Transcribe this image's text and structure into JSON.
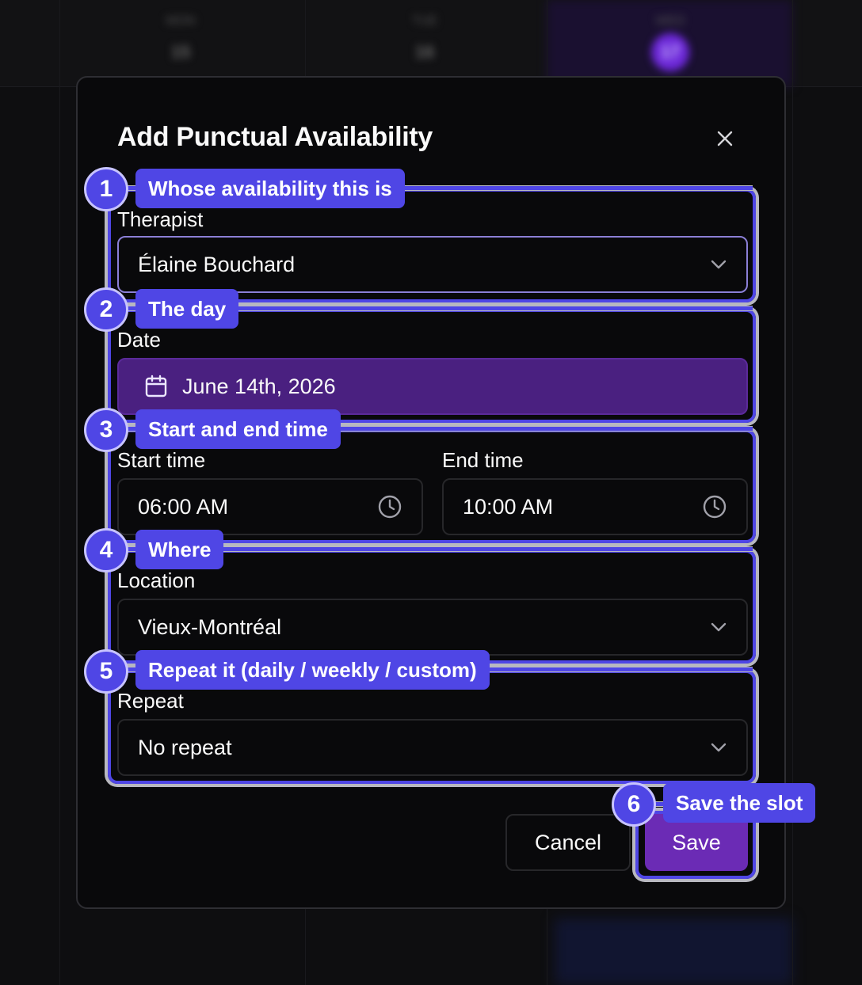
{
  "background": {
    "days": [
      {
        "weekday": "MON",
        "number": "15"
      },
      {
        "weekday": "TUE",
        "number": "16"
      },
      {
        "weekday": "WED",
        "number": "17"
      }
    ]
  },
  "dialog": {
    "title": "Add Punctual Availability",
    "close_icon": "close-icon",
    "therapist": {
      "label": "Therapist",
      "value": "Élaine Bouchard"
    },
    "date": {
      "label": "Date",
      "value": "June 14th, 2026",
      "icon": "calendar-icon"
    },
    "start_time": {
      "label": "Start time",
      "value": "06:00 AM",
      "icon": "clock-icon"
    },
    "end_time": {
      "label": "End time",
      "value": "10:00 AM",
      "icon": "clock-icon"
    },
    "location": {
      "label": "Location",
      "value": "Vieux-Montréal"
    },
    "repeat": {
      "label": "Repeat",
      "value": "No repeat"
    },
    "buttons": {
      "cancel": "Cancel",
      "save": "Save"
    }
  },
  "annotations": [
    {
      "number": "1",
      "text": "Whose availability this is"
    },
    {
      "number": "2",
      "text": "The day"
    },
    {
      "number": "3",
      "text": "Start and end time"
    },
    {
      "number": "4",
      "text": "Where"
    },
    {
      "number": "5",
      "text": "Repeat it (daily / weekly / custom)"
    },
    {
      "number": "6",
      "text": "Save the slot"
    }
  ],
  "colors": {
    "annotation": "#4f46e5",
    "accent_purple": "#6b2bb5",
    "date_field": "#4a2080",
    "surface": "#09090b"
  }
}
